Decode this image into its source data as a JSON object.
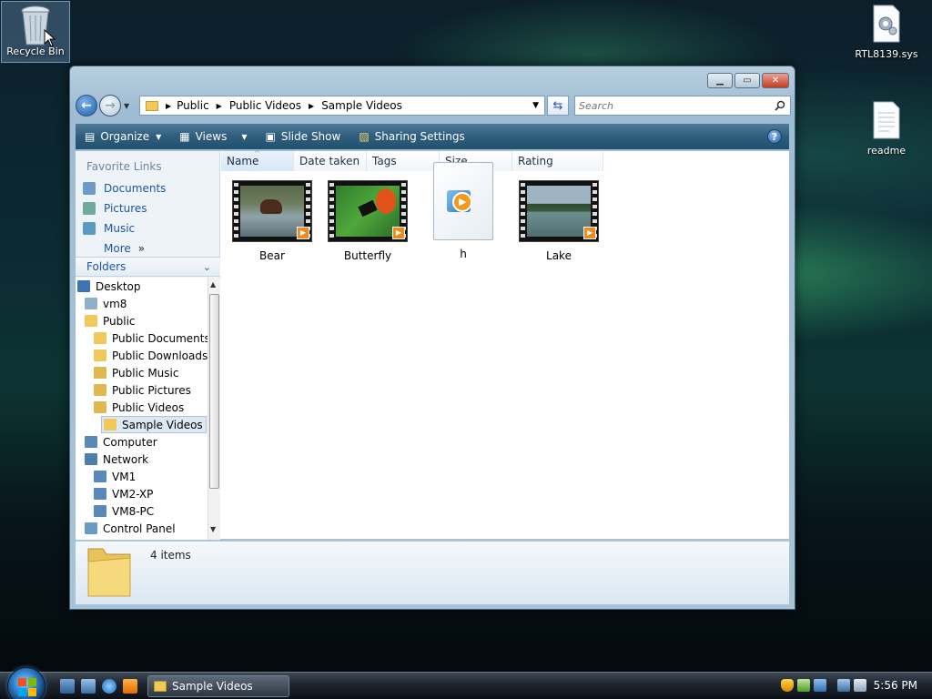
{
  "desktop": {
    "icons": [
      {
        "label": "Recycle Bin",
        "icon": "recycle-bin-icon"
      },
      {
        "label": "RTL8139.sys",
        "icon": "system-file-icon"
      },
      {
        "label": "readme",
        "icon": "text-document-icon"
      }
    ]
  },
  "window": {
    "controls": {
      "minimize": "minimize",
      "maximize": "maximize",
      "close": "close"
    },
    "breadcrumb": [
      "Public",
      "Public Videos",
      "Sample Videos"
    ],
    "search": {
      "placeholder": "Search"
    },
    "toolbar": {
      "organize": "Organize",
      "views": "Views",
      "slide_show": "Slide Show",
      "sharing": "Sharing Settings"
    },
    "favorites": {
      "title": "Favorite Links",
      "items": [
        "Documents",
        "Pictures",
        "Music",
        "More"
      ]
    },
    "folders_label": "Folders",
    "tree": [
      "Desktop",
      "vm8",
      "Public",
      "Public Documents",
      "Public Downloads",
      "Public Music",
      "Public Pictures",
      "Public Videos",
      "Sample Videos",
      "Computer",
      "Network",
      "VM1",
      "VM2-XP",
      "VM8-PC",
      "Control Panel"
    ],
    "columns": [
      "Name",
      "Date taken",
      "Tags",
      "Size",
      "Rating"
    ],
    "files": [
      "Bear",
      "Butterfly",
      "h",
      "Lake"
    ],
    "status": {
      "count": "4 items"
    }
  },
  "taskbar": {
    "task": "Sample Videos",
    "clock": "5:56 PM"
  },
  "colors": {
    "accent": "#1a56a6",
    "toolbar": "#2f5d7d",
    "taskbar": "#1d252e"
  }
}
